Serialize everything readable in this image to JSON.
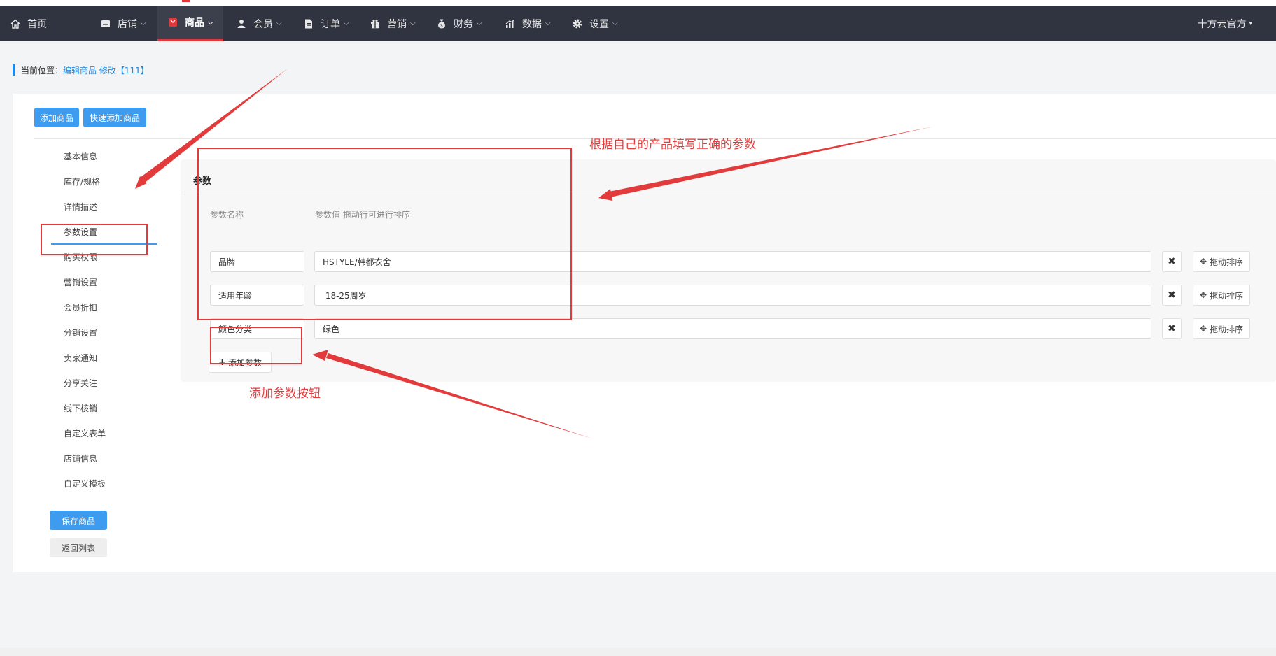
{
  "nav": {
    "home": "首页",
    "items": [
      {
        "label": "店铺",
        "icon": "store-icon"
      },
      {
        "label": "商品",
        "icon": "goods-icon"
      },
      {
        "label": "会员",
        "icon": "user-icon"
      },
      {
        "label": "订单",
        "icon": "order-icon"
      },
      {
        "label": "营销",
        "icon": "gift-icon"
      },
      {
        "label": "财务",
        "icon": "money-bag-icon"
      },
      {
        "label": "数据",
        "icon": "bar-chart-icon"
      },
      {
        "label": "设置",
        "icon": "gear-icon"
      }
    ],
    "account": "十方云官方",
    "active_color": "#e0373b"
  },
  "breadcrumb": {
    "label": "当前位置：",
    "link": "编辑商品 修改【111】"
  },
  "toolbar": {
    "add_goods": "添加商品",
    "quick_add_goods": "快速添加商品"
  },
  "side_menu": [
    "基本信息",
    "库存/规格",
    "详情描述",
    "参数设置",
    "购买权限",
    "营销设置",
    "会员折扣",
    "分销设置",
    "卖家通知",
    "分享关注",
    "线下核销",
    "自定义表单",
    "店铺信息",
    "自定义模板"
  ],
  "actions": {
    "save": "保存商品",
    "back": "返回列表"
  },
  "params": {
    "title": "参数",
    "col_name": "参数名称",
    "col_value": "参数值 拖动行可进行排序",
    "rows": [
      {
        "name": "品牌",
        "value": "HSTYLE/韩都衣舍"
      },
      {
        "name": "适用年龄",
        "value": " 18-25周岁"
      },
      {
        "name": "颜色分类",
        "value": "绿色"
      }
    ],
    "delete_symbol": "✖",
    "drag_label": "拖动排序",
    "add_button": "添加参数"
  },
  "annotations": {
    "fill_params": "根据自己的产品填写正确的参数",
    "add_button_note": "添加参数按钮",
    "color": "#e33b3b"
  }
}
